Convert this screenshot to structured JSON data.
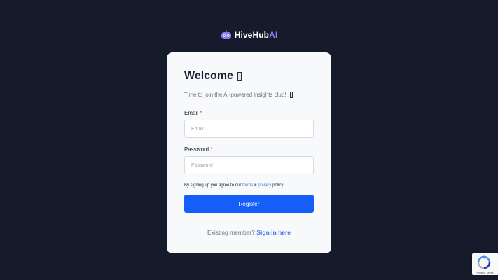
{
  "brand": {
    "name_main": "HiveHub",
    "name_accent": "AI",
    "logo_icon": "robot-face-icon",
    "accent_color": "#8b7cf6"
  },
  "card": {
    "title": "Welcome",
    "subtitle": "Time to join the AI-powered insights club!"
  },
  "form": {
    "email": {
      "label": "Email",
      "required_mark": "*",
      "placeholder": "Email",
      "value": ""
    },
    "password": {
      "label": "Password",
      "required_mark": "*",
      "placeholder": "Password",
      "value": ""
    },
    "terms": {
      "prefix": "By signing up you agree to our",
      "terms_link": "terms",
      "joiner": "&",
      "privacy_link": "privacy",
      "suffix": "policy."
    },
    "submit_label": "Register",
    "submit_color": "#155efa"
  },
  "footer": {
    "existing_text": "Existing member?",
    "signin_link": "Sign in here"
  },
  "recaptcha": {
    "icon": "recaptcha-icon",
    "privacy": "Privacy",
    "separator": "-",
    "terms": "Terms"
  },
  "colors": {
    "page_background": "#161b2b",
    "card_background": "#f8f9fa",
    "link": "#3b73e6",
    "required": "#e5484d"
  }
}
